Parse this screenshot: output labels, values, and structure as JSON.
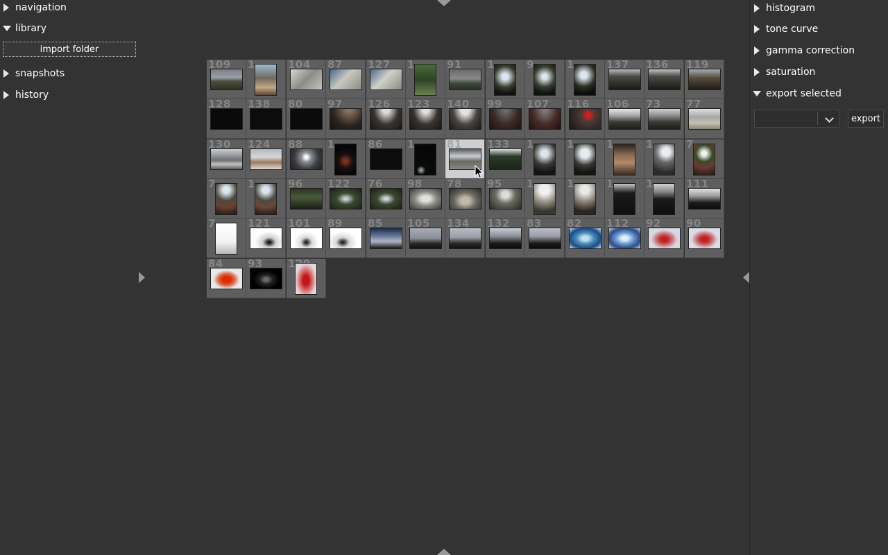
{
  "left_panel": {
    "sections": [
      {
        "label": "navigation",
        "expanded": false
      },
      {
        "label": "library",
        "expanded": true
      },
      {
        "label": "snapshots",
        "expanded": false
      },
      {
        "label": "history",
        "expanded": false
      }
    ],
    "import_button": "import folder"
  },
  "right_panel": {
    "sections": [
      {
        "label": "histogram",
        "expanded": false
      },
      {
        "label": "tone curve",
        "expanded": false
      },
      {
        "label": "gamma correction",
        "expanded": false
      },
      {
        "label": "saturation",
        "expanded": false
      },
      {
        "label": "export selected",
        "expanded": true
      }
    ],
    "export_format": "",
    "export_button": "export"
  },
  "thumbnails": [
    {
      "id": "109",
      "orient": "l",
      "bg": "linear-gradient(#7a7f86 0%,#9aa0a8 40%,#4a4f3c 60%,#2c2f22 100%)"
    },
    {
      "id": "1",
      "orient": "p",
      "bg": "linear-gradient(#9fb8d0 0%,#6e6a5e 45%,#c8a886 75%,#5a4a3a 100%)"
    },
    {
      "id": "104",
      "orient": "l",
      "bg": "linear-gradient(135deg,#d8d8d2,#8c8c86 50%,#c4c4be)"
    },
    {
      "id": "87",
      "orient": "l",
      "bg": "linear-gradient(135deg,#4a6a8c,#c8c8c0 45%,#8a8a80)"
    },
    {
      "id": "127",
      "orient": "l",
      "bg": "linear-gradient(135deg,#4a6a8c,#d0d0c8 45%,#8a8a80)"
    },
    {
      "id": "1",
      "orient": "p",
      "bg": "linear-gradient(#4a6a3a,#2c4424 50%,#6a8050)"
    },
    {
      "id": "91",
      "orient": "l",
      "bg": "linear-gradient(#6a6a6a,#8a8a88 45%,#3a4a38 70%,#2a3028)"
    },
    {
      "id": "1",
      "orient": "p",
      "bg": "radial-gradient(circle at 50% 40%,#d8e4f0 15%,#3a4030 50%,#101210 80%)"
    },
    {
      "id": "9",
      "orient": "p",
      "bg": "radial-gradient(circle at 50% 40%,#dce6ee 12%,#3a4030 48%,#101210 80%)"
    },
    {
      "id": "1",
      "orient": "p",
      "bg": "radial-gradient(circle at 45% 35%,#dce6ee 14%,#2c3024 50%,#0c0e0c 80%)"
    },
    {
      "id": "137",
      "orient": "l",
      "bg": "linear-gradient(#b8bcc0 0%,#4a4a44 35%,#1a1a16 100%)"
    },
    {
      "id": "136",
      "orient": "l",
      "bg": "linear-gradient(#c0c4c8 0%,#4a4a44 35%,#1a1a16 100%)"
    },
    {
      "id": "119",
      "orient": "l",
      "bg": "linear-gradient(#a8acb0 0%,#5a4e40 40%,#1e1a16 100%)"
    },
    {
      "id": "128",
      "orient": "l",
      "bg": "#0a0a0a"
    },
    {
      "id": "138",
      "orient": "l",
      "bg": "#0c0c0c"
    },
    {
      "id": "80",
      "orient": "l",
      "bg": "#0b0b0b"
    },
    {
      "id": "97",
      "orient": "l",
      "bg": "radial-gradient(ellipse at 60% 0%,#8a7060 10%,#2a2420 60%,#141210)"
    },
    {
      "id": "126",
      "orient": "l",
      "bg": "radial-gradient(ellipse at 50% 0%,#dcdcdc 15%,#3a3430 55%,#1a1614)"
    },
    {
      "id": "123",
      "orient": "l",
      "bg": "radial-gradient(ellipse at 50% 0%,#e0e0e0 15%,#3a3430 55%,#1a1614)"
    },
    {
      "id": "140",
      "orient": "l",
      "bg": "radial-gradient(ellipse at 50% 0%,#e4e4e4 20%,#4a4440 55%,#1c1816)"
    },
    {
      "id": "99",
      "orient": "l",
      "bg": "radial-gradient(ellipse at 50% 0%,#6a6a6a 10%,#3a2a26 55%,#1a1210)"
    },
    {
      "id": "107",
      "orient": "l",
      "bg": "radial-gradient(ellipse at 50% 0%,#7a7a7a 10%,#4a2a26 55%,#1a1210)"
    },
    {
      "id": "116",
      "orient": "l",
      "bg": "radial-gradient(circle at 60% 30%,#d02020 8%,#4a3a36 30%,#1a1614)"
    },
    {
      "id": "106",
      "orient": "l",
      "bg": "linear-gradient(#e8e8e8 0%,#a0a0a0 35%,#3a3a34 65%,#1e1e1a)"
    },
    {
      "id": "73",
      "orient": "l",
      "bg": "linear-gradient(#d0d0d0 0%,#8a8a8a 35%,#3a3a34 65%,#1e1e1a)"
    },
    {
      "id": "77",
      "orient": "l",
      "bg": "linear-gradient(#e0e0e0 0%,#a8a8a8 40%,#c8c0b0 70%,#8a8478)"
    },
    {
      "id": "130",
      "orient": "l",
      "bg": "linear-gradient(#c8ccd0 0%,#909498 35%,#707070 55%,#c0c4c8 75%,#5a5a56)"
    },
    {
      "id": "124",
      "orient": "l",
      "bg": "linear-gradient(#b0b8c0 0%,#d8d8d8 40%,#9a7a60 65%,#e0d8d0)"
    },
    {
      "id": "88",
      "orient": "l",
      "bg": "radial-gradient(circle at 50% 40%,#ffffff 6%,#8a8e94 25%,#3a3c40 60%,#202224)"
    },
    {
      "id": "1",
      "orient": "p",
      "bg": "radial-gradient(circle at 50% 55%,#7a3020 10%,#1a1010 35%,#060606 70%)"
    },
    {
      "id": "86",
      "orient": "l",
      "bg": "#0e0c0a"
    },
    {
      "id": "1",
      "orient": "p",
      "bg": "radial-gradient(circle at 30% 85%,#8a9aa0 3%,#0a0a0a 15%,#050505)"
    },
    {
      "id": "81",
      "orient": "l",
      "bg": "linear-gradient(#5a5e62 0%,#c8ccd0 35%,#6a6a64 60%,#8a8680)"
    },
    {
      "id": "133",
      "orient": "l",
      "bg": "linear-gradient(#d8dce0 0%,#2a3a28 35%,#1c2418 100%)"
    },
    {
      "id": "1",
      "orient": "p",
      "bg": "radial-gradient(circle at 50% 30%,#dce6ee 14%,#3a3a34 48%,#141414 80%)"
    },
    {
      "id": "1",
      "orient": "p",
      "bg": "radial-gradient(circle at 50% 30%,#e4ecf2 18%,#3a3a34 50%,#141414 80%)"
    },
    {
      "id": "1",
      "orient": "p",
      "bg": "linear-gradient(#2a2420 0%,#8a6a50 35%,#b08a6a 60%,#3a2c20)"
    },
    {
      "id": "1",
      "orient": "p",
      "bg": "radial-gradient(circle at 60% 25%,#e8eef4 15%,#6a6a6a 40%,#2a2a2a 80%)"
    },
    {
      "id": "7",
      "orient": "p",
      "bg": "radial-gradient(circle at 50% 30%,#f0f0f0 10%,#3a4a2a 35%,#6a3a30 60%,#1a1a16)"
    },
    {
      "id": "7",
      "orient": "p",
      "bg": "radial-gradient(circle at 50% 20%,#dce6ee 12%,#4a4a40 40%,#6a4030 65%,#1a1814)"
    },
    {
      "id": "1",
      "orient": "p",
      "bg": "radial-gradient(circle at 50% 20%,#dce6ee 12%,#4a4a40 40%,#6a4838 65%,#1a1814)"
    },
    {
      "id": "96",
      "orient": "l",
      "bg": "linear-gradient(#2a3424 0%,#4a5a3a 40%,#1a1e16 100%)"
    },
    {
      "id": "122",
      "orient": "l",
      "bg": "radial-gradient(ellipse at 50% 50%,#c8ccd0 8%,#3a4a30 40%,#1a2014)"
    },
    {
      "id": "76",
      "orient": "l",
      "bg": "radial-gradient(ellipse at 50% 50%,#d0d4d8 8%,#3a4a30 40%,#1a2014)"
    },
    {
      "id": "98",
      "orient": "l",
      "bg": "radial-gradient(ellipse at 50% 50%,#e0e0dc 20%,#8a8a84 50%,#3a3a34)"
    },
    {
      "id": "78",
      "orient": "l",
      "bg": "radial-gradient(ellipse at 50% 60%,#c0b8a8 20%,#6a6a60 50%,#2a2a24)"
    },
    {
      "id": "95",
      "orient": "l",
      "bg": "radial-gradient(ellipse at 50% 30%,#dcdcdc 15%,#6a6a60 45%,#2a2a24)"
    },
    {
      "id": "1",
      "orient": "p",
      "bg": "radial-gradient(circle at 50% 20%,#f0f0f0 18%,#9a9488 45%,#3a3630 80%)"
    },
    {
      "id": "1",
      "orient": "p",
      "bg": "radial-gradient(circle at 50% 20%,#e8e8e8 15%,#8a8478 45%,#2a2620 80%)"
    },
    {
      "id": "1",
      "orient": "p",
      "bg": "linear-gradient(#c8c8c8 0%,#1a1a1a 30%,#0e0e0e 100%)"
    },
    {
      "id": "1",
      "orient": "p",
      "bg": "linear-gradient(#d0d0d0 0%,#8a8a8a 25%,#1a1a1a 50%,#0e0e0e 100%)"
    },
    {
      "id": "111",
      "orient": "l",
      "bg": "linear-gradient(#e0e0e0 0%,#a0a0a0 35%,#1a1a1a 70%,#0e0e0e)"
    },
    {
      "id": "7",
      "orient": "p",
      "bg": "linear-gradient(#ffffff 0%,#f4f4f4 60%,#b8b8b8 100%)"
    },
    {
      "id": "121",
      "orient": "l",
      "bg": "radial-gradient(ellipse at 60% 70%,#1a1a1a 5%,#d0d0d0 25%,#ffffff 55%)"
    },
    {
      "id": "101",
      "orient": "l",
      "bg": "radial-gradient(ellipse at 50% 70%,#2a2a2a 5%,#d8d8d8 25%,#ffffff 55%)"
    },
    {
      "id": "89",
      "orient": "l",
      "bg": "radial-gradient(ellipse at 40% 70%,#2a2a2a 5%,#d8d8d8 25%,#ffffff 55%)"
    },
    {
      "id": "85",
      "orient": "l",
      "bg": "linear-gradient(#1a2a4a 0%,#6a7a9a 40%,#b0b8c8 65%,#1a1a1a)"
    },
    {
      "id": "105",
      "orient": "l",
      "bg": "linear-gradient(#a8acb4 0%,#8a8e98 50%,#2a2a2a 75%,#101010)"
    },
    {
      "id": "134",
      "orient": "l",
      "bg": "linear-gradient(#b8bcc4 0%,#9a9ea6 45%,#2a2a2a 75%,#101010)"
    },
    {
      "id": "132",
      "orient": "l",
      "bg": "linear-gradient(#c8ccd4 0%,#8a8e96 40%,#1a1a1a 75%,#0c0c0c)"
    },
    {
      "id": "83",
      "orient": "l",
      "bg": "linear-gradient(#b8bcc4 0%,#9a9ea6 40%,#1a1a1a 75%,#0c0c0c)"
    },
    {
      "id": "82",
      "orient": "l",
      "bg": "radial-gradient(ellipse at 50% 50%,#c0e0f0 15%,#4a8ab8 40%,#1a4a88 70%,#dceaf4)"
    },
    {
      "id": "112",
      "orient": "l",
      "bg": "radial-gradient(ellipse at 50% 50%,#e0eef8 15%,#6a9ad0 40%,#2a4a88 70%,#c8d8e8)"
    },
    {
      "id": "92",
      "orient": "l",
      "bg": "radial-gradient(ellipse at 50% 55%,#c02020 15%,#c86a6a 35%,#d8d8e4 60%)"
    },
    {
      "id": "90",
      "orient": "l",
      "bg": "radial-gradient(ellipse at 50% 55%,#c02020 15%,#c86a6a 35%,#dcdce8 60%)"
    },
    {
      "id": "84",
      "orient": "l",
      "bg": "radial-gradient(ellipse at 50% 55%,#e02a00 18%,#d8603a 35%,#e8e8ec 60%)"
    },
    {
      "id": "93",
      "orient": "l",
      "bg": "radial-gradient(ellipse at 50% 55%,#6a6a6a 10%,#202020 30%,#000000 60%)"
    },
    {
      "id": "129",
      "orient": "p",
      "bg": "radial-gradient(ellipse at 50% 55%,#c01818 20%,#d86060 40%,#e0d8dc 70%)"
    }
  ],
  "selected_index": 32
}
